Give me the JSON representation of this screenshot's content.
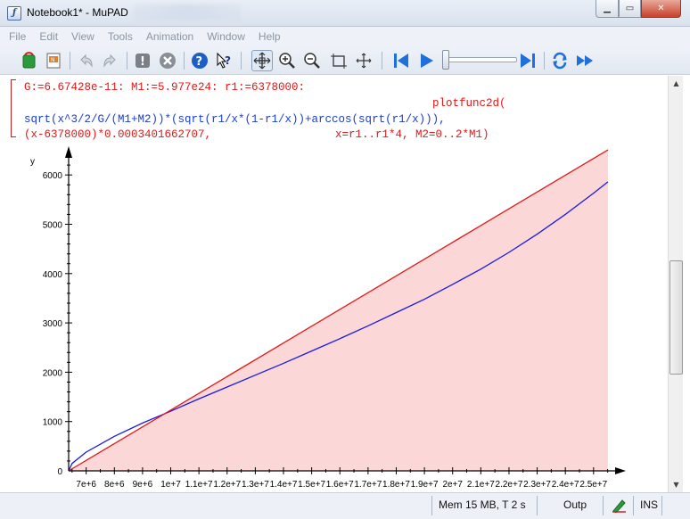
{
  "window": {
    "title": "Notebook1* - MuPAD"
  },
  "menu": [
    "File",
    "Edit",
    "View",
    "Tools",
    "Animation",
    "Window",
    "Help"
  ],
  "toolbar": {
    "icons": [
      "new-notebook-icon",
      "open-icon",
      "undo-icon",
      "redo-icon",
      "evaluate-icon",
      "stop-icon",
      "help-icon",
      "context-help-icon",
      "select-icon",
      "zoom-in-icon",
      "zoom-out-icon",
      "zoom-box-icon",
      "rotate-icon",
      "animation-start-icon",
      "play-icon",
      "animation-end-icon",
      "repeat-icon",
      "fast-forward-icon"
    ]
  },
  "notebook": {
    "input_line1": "G:=6.67428e-11: M1:=5.977e24: r1:=6378000:",
    "input_line2": "plotfunc2d(",
    "input_line3": "sqrt(x^3/2/G/(M1+M2))*(sqrt(r1/x*(1-r1/x))+arccos(sqrt(r1/x))),",
    "input_line4a": "(x-6378000)*0.0003401662707,",
    "input_line4b": "x=r1..r1*4, M2=0..2*M1)"
  },
  "chart_data": {
    "type": "line",
    "title": "",
    "xlabel": "",
    "ylabel": "y",
    "xlim": [
      6378000,
      25512000
    ],
    "ylim": [
      0,
      6600
    ],
    "x_tick_labels": [
      "7e+6",
      "8e+6",
      "9e+6",
      "1e+7",
      "1.1e+7",
      "1.2e+7",
      "1.3e+7",
      "1.4e+7",
      "1.5e+7",
      "1.6e+7",
      "1.7e+7",
      "1.8e+7",
      "1.9e+7",
      "2e+7",
      "2.1e+7",
      "2.2e+7",
      "2.3e+7",
      "2.4e+7",
      "2.5e+7"
    ],
    "x_tick_values": [
      7000000,
      8000000,
      9000000,
      10000000,
      11000000,
      12000000,
      13000000,
      14000000,
      15000000,
      16000000,
      17000000,
      18000000,
      19000000,
      20000000,
      21000000,
      22000000,
      23000000,
      24000000,
      25000000
    ],
    "y_ticks": [
      1000,
      2000,
      3000,
      4000,
      5000,
      6000
    ],
    "series": [
      {
        "color": "#1a1adf",
        "x": [
          6378000,
          6500000,
          7000000,
          8000000,
          9000000,
          10000000,
          11000000,
          12000000,
          13000000,
          14000000,
          15000000,
          16000000,
          17000000,
          18000000,
          19000000,
          20000000,
          21000000,
          22000000,
          23000000,
          24000000,
          25000000,
          25512000
        ],
        "y": [
          0,
          150,
          380,
          700,
          970,
          1210,
          1460,
          1700,
          1940,
          2180,
          2430,
          2680,
          2940,
          3210,
          3480,
          3780,
          4090,
          4430,
          4800,
          5200,
          5630,
          5860
        ]
      },
      {
        "color": "#e01818",
        "x": [
          6378000,
          25512000
        ],
        "y": [
          0,
          6509
        ]
      }
    ],
    "fill": {
      "color": "#fbd7d7",
      "under_series": 1
    },
    "grid": false,
    "legend": "none"
  },
  "statusbar": {
    "memory": "Mem 15 MB, T 2 s",
    "mode": "Outp",
    "insert": "INS"
  }
}
